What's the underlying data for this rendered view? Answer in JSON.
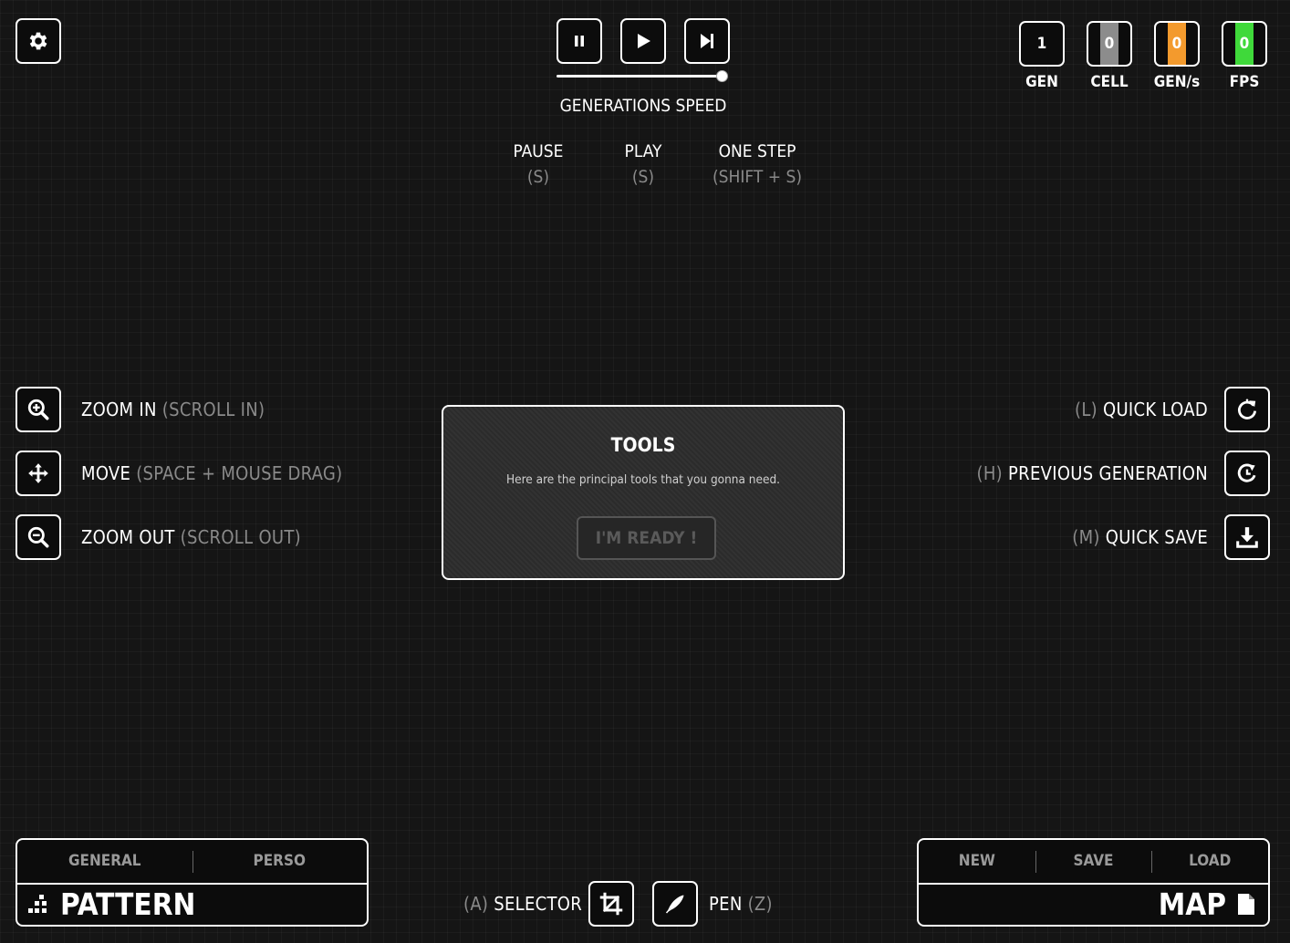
{
  "settings": {
    "icon": "gear-icon"
  },
  "playback": {
    "pause_icon": "pause-icon",
    "play_icon": "play-icon",
    "step_icon": "next-step-icon",
    "speed_label": "GENERATIONS SPEED",
    "speed_value": 1.0
  },
  "shortcuts_top": [
    {
      "label": "PAUSE",
      "key": "(S)"
    },
    {
      "label": "PLAY",
      "key": "(S)"
    },
    {
      "label": "ONE STEP",
      "key": "(SHIFT + S)"
    }
  ],
  "stats": [
    {
      "label": "GEN",
      "value": "1",
      "fill": 0,
      "color": "#000000"
    },
    {
      "label": "CELL",
      "value": "0",
      "fill": 0.45,
      "color": "#8c8c8c"
    },
    {
      "label": "GEN/s",
      "value": "0",
      "fill": 0.45,
      "color": "#f39a2d"
    },
    {
      "label": "FPS",
      "value": "0",
      "fill": 0.45,
      "color": "#3fd93a"
    }
  ],
  "left_tools": [
    {
      "label": "ZOOM IN",
      "hint": "(SCROLL IN)",
      "icon": "zoom-in-icon"
    },
    {
      "label": "MOVE",
      "hint": "(SPACE + MOUSE DRAG)",
      "icon": "move-icon"
    },
    {
      "label": "ZOOM OUT",
      "hint": "(SCROLL OUT)",
      "icon": "zoom-out-icon"
    }
  ],
  "right_tools": [
    {
      "key": "(L)",
      "label": "QUICK LOAD",
      "icon": "quick-load-icon"
    },
    {
      "key": "(H)",
      "label": "PREVIOUS GENERATION",
      "icon": "previous-generation-icon"
    },
    {
      "key": "(M)",
      "label": "QUICK SAVE",
      "icon": "download-icon"
    }
  ],
  "modal": {
    "title": "TOOLS",
    "text": "Here are the principal tools that you gonna need.",
    "button": "I'M READY !"
  },
  "pattern_panel": {
    "tabs": [
      "GENERAL",
      "PERSO"
    ],
    "title": "PATTERN",
    "icon": "pattern-icon"
  },
  "bottom_tools": {
    "selector_key": "(A)",
    "selector_label": "SELECTOR",
    "selector_icon": "crop-icon",
    "pen_label": "PEN",
    "pen_key": "(Z)",
    "pen_icon": "pen-icon"
  },
  "map_panel": {
    "tabs": [
      "NEW",
      "SAVE",
      "LOAD"
    ],
    "title": "MAP",
    "icon": "file-icon"
  }
}
